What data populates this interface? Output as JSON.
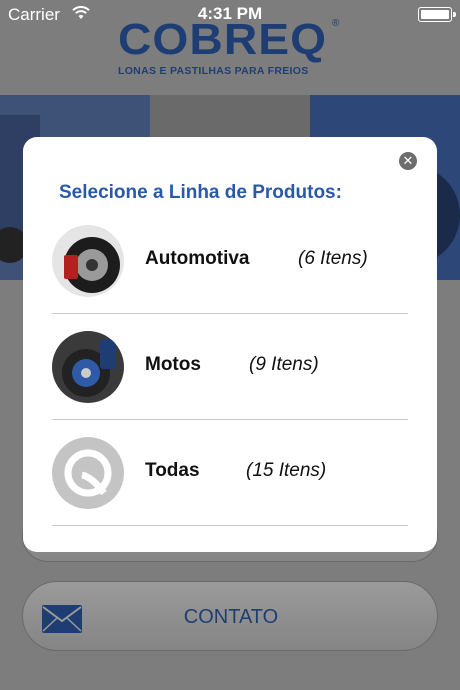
{
  "status_bar": {
    "carrier": "Carrier",
    "time": "4:31 PM"
  },
  "logo": {
    "brand": "COBREQ",
    "registered": "®",
    "tagline": "LONAS E PASTILHAS PARA FREIOS"
  },
  "modal": {
    "title": "Selecione a Linha de Produtos:",
    "options": [
      {
        "name": "Automotiva",
        "count": "(6 Itens)"
      },
      {
        "name": "Motos",
        "count": "(9 Itens)"
      },
      {
        "name": "Todas",
        "count": "(15 Itens)"
      }
    ]
  },
  "contact": {
    "label": "CONTATO"
  },
  "colors": {
    "brand_blue": "#1e3e73",
    "title_blue": "#2a5aa6"
  }
}
